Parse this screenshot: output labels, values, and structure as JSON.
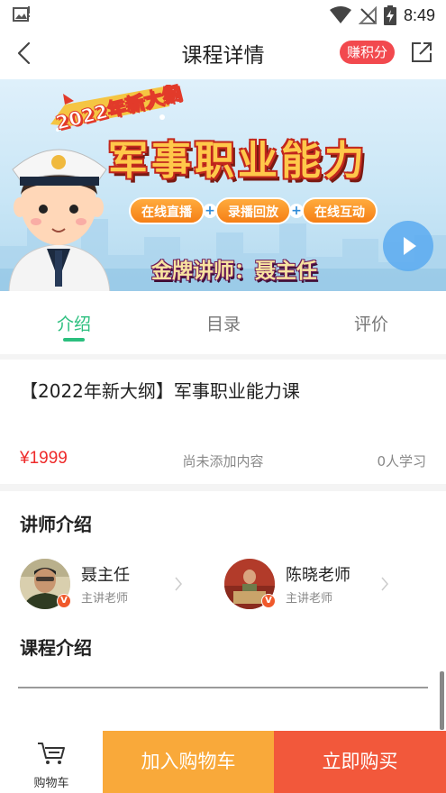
{
  "status_bar": {
    "time": "8:49"
  },
  "nav": {
    "title": "课程详情",
    "badge": "赚积分"
  },
  "banner": {
    "ribbon": "2022年新大纲",
    "title": "军事职业能力",
    "pills": [
      "在线直播",
      "录播回放",
      "在线互动"
    ],
    "teacher_line": "金牌讲师：聂主任"
  },
  "tabs": [
    {
      "label": "介绍",
      "active": true
    },
    {
      "label": "目录",
      "active": false
    },
    {
      "label": "评价",
      "active": false
    }
  ],
  "course": {
    "title": "【2022年新大纲】军事职业能力课",
    "price": "¥1999",
    "price_note": "尚未添加内容",
    "learners": "0人学习"
  },
  "lecturers_section": {
    "title": "讲师介绍",
    "items": [
      {
        "name": "聂主任",
        "role": "主讲老师"
      },
      {
        "name": "陈晓老师",
        "role": "主讲老师"
      }
    ]
  },
  "course_intro": {
    "title": "课程介绍"
  },
  "bottom_bar": {
    "cart_label": "购物车",
    "add_to_cart": "加入购物车",
    "buy_now": "立即购买"
  },
  "colors": {
    "accent_green": "#2bbf7e",
    "price_red": "#ee2b2b",
    "badge_red": "#f2494e",
    "cart_orange": "#f9a93a",
    "buy_red": "#f2583b"
  }
}
